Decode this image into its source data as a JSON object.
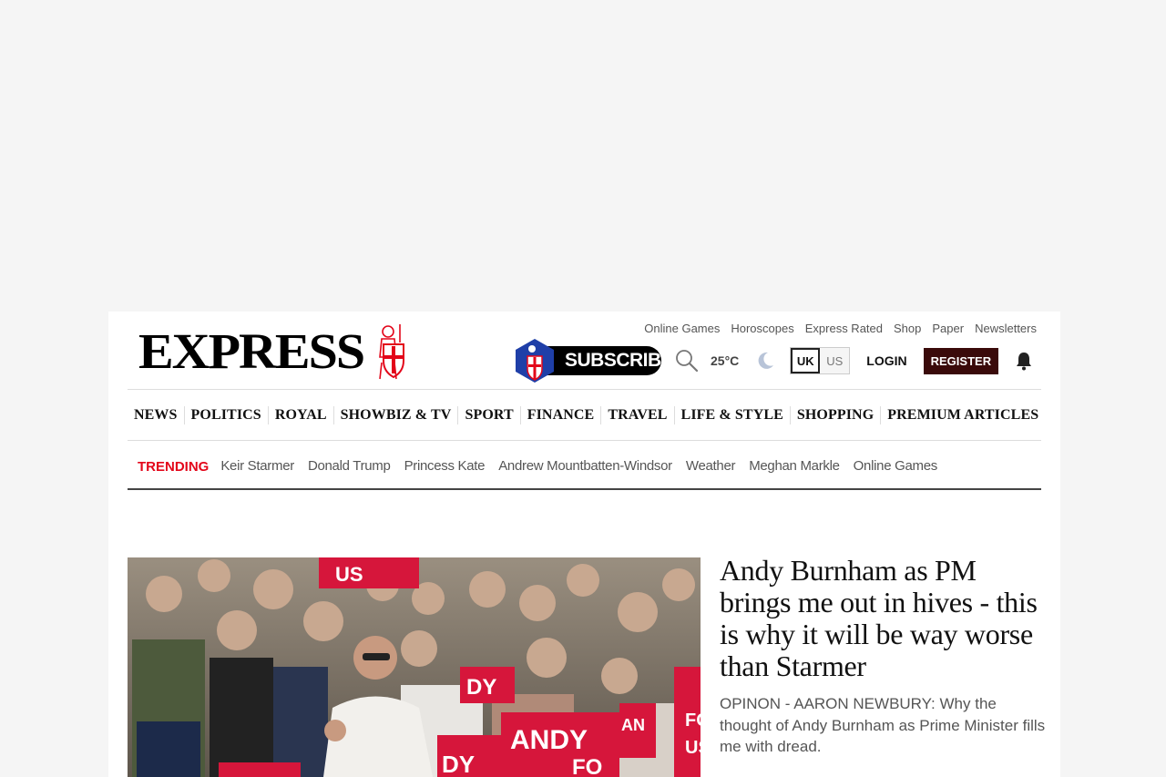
{
  "brand": {
    "logo_text": "EXPRESS",
    "accent": "#e3061a",
    "register_bg": "#3a0a0a"
  },
  "utility_links": [
    "Online Games",
    "Horoscopes",
    "Express Rated",
    "Shop",
    "Paper",
    "Newsletters"
  ],
  "header": {
    "subscribe_label": "SUBSCRIBE",
    "temperature": "25°C",
    "edition_uk": "UK",
    "edition_us": "US",
    "login_label": "LOGIN",
    "register_label": "REGISTER"
  },
  "nav": [
    "NEWS",
    "POLITICS",
    "ROYAL",
    "SHOWBIZ & TV",
    "SPORT",
    "FINANCE",
    "TRAVEL",
    "LIFE & STYLE",
    "SHOPPING",
    "PREMIUM ARTICLES"
  ],
  "trending": {
    "label": "TRENDING",
    "items": [
      "Keir Starmer",
      "Donald Trump",
      "Princess Kate",
      "Andrew Mountbatten-Windsor",
      "Weather",
      "Meghan Markle",
      "Online Games"
    ]
  },
  "lead_story": {
    "headline": "Andy Burnham as PM brings me out in hives - this is why it will be way worse than Starmer",
    "standfirst": "OPINON - AARON NEWBURY: Why the thought of Andy Burnham as Prime Minister fills me with dread.",
    "image_placards": [
      "US",
      "ANDY",
      "FOR",
      "US",
      "DY",
      "DY",
      "AN",
      "FO"
    ]
  }
}
